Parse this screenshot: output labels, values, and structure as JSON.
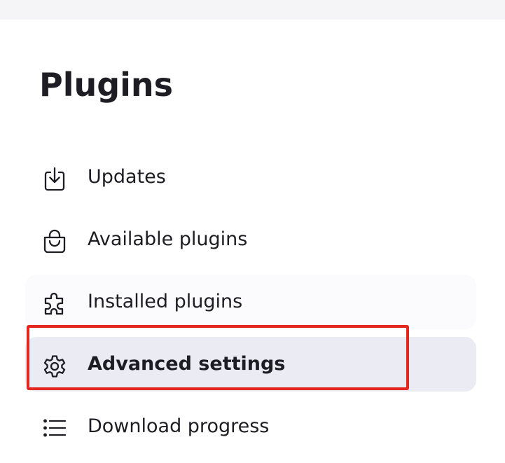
{
  "page": {
    "title": "Plugins"
  },
  "nav": {
    "items": [
      {
        "label": "Updates",
        "icon": "download-tray-icon",
        "active": false
      },
      {
        "label": "Available plugins",
        "icon": "shopping-bag-icon",
        "active": false
      },
      {
        "label": "Installed plugins",
        "icon": "puzzle-piece-icon",
        "active": false
      },
      {
        "label": "Advanced settings",
        "icon": "gear-icon",
        "active": true
      },
      {
        "label": "Download progress",
        "icon": "list-icon",
        "active": false
      }
    ]
  },
  "colors": {
    "text": "#1d1d23",
    "active_background": "#ebebf3",
    "hover_background": "#fbfbfd",
    "top_strip": "#f5f5f7",
    "highlight_border": "#e3271f"
  }
}
